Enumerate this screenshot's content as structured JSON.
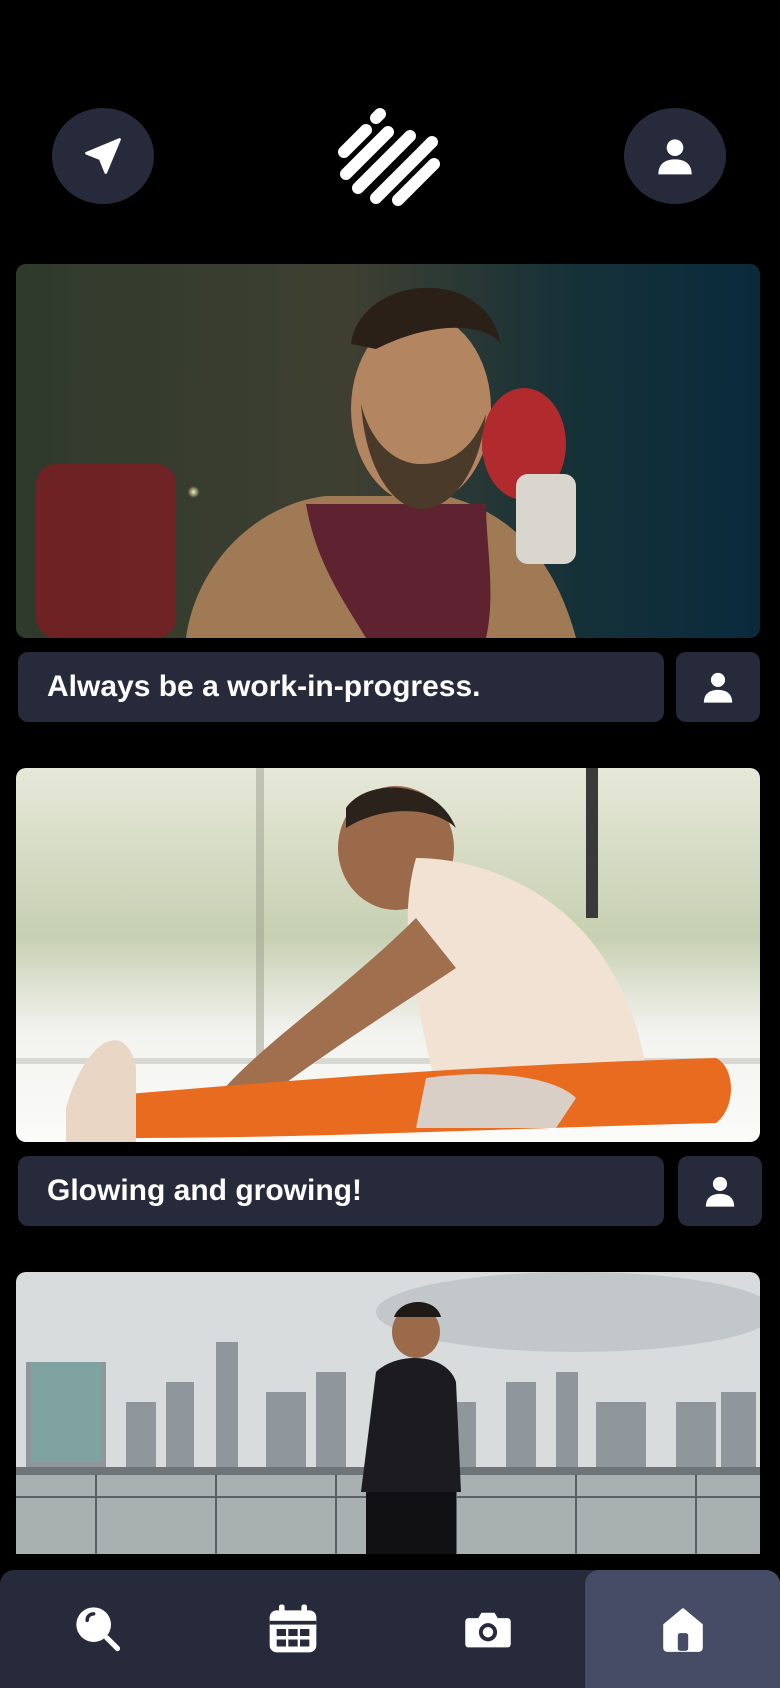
{
  "header": {
    "left_icon": "send-icon",
    "logo_icon": "stripes-logo",
    "right_icon": "user-icon"
  },
  "feed": {
    "posts": [
      {
        "caption": "Always be a work-in-progress.",
        "image": "boxer-photo",
        "author_icon": "user-icon"
      },
      {
        "caption": "Glowing and growing!",
        "image": "stretching-photo",
        "author_icon": "user-icon"
      },
      {
        "caption": "",
        "image": "runner-skyline-photo",
        "author_icon": ""
      }
    ]
  },
  "bottom_nav": {
    "items": [
      {
        "icon": "search-icon",
        "active": false
      },
      {
        "icon": "calendar-icon",
        "active": false
      },
      {
        "icon": "camera-icon",
        "active": false
      },
      {
        "icon": "home-icon",
        "active": true
      }
    ]
  },
  "colors": {
    "background": "#000000",
    "surface": "#262a3a",
    "nav_active": "#474c66",
    "text": "#ffffff"
  }
}
